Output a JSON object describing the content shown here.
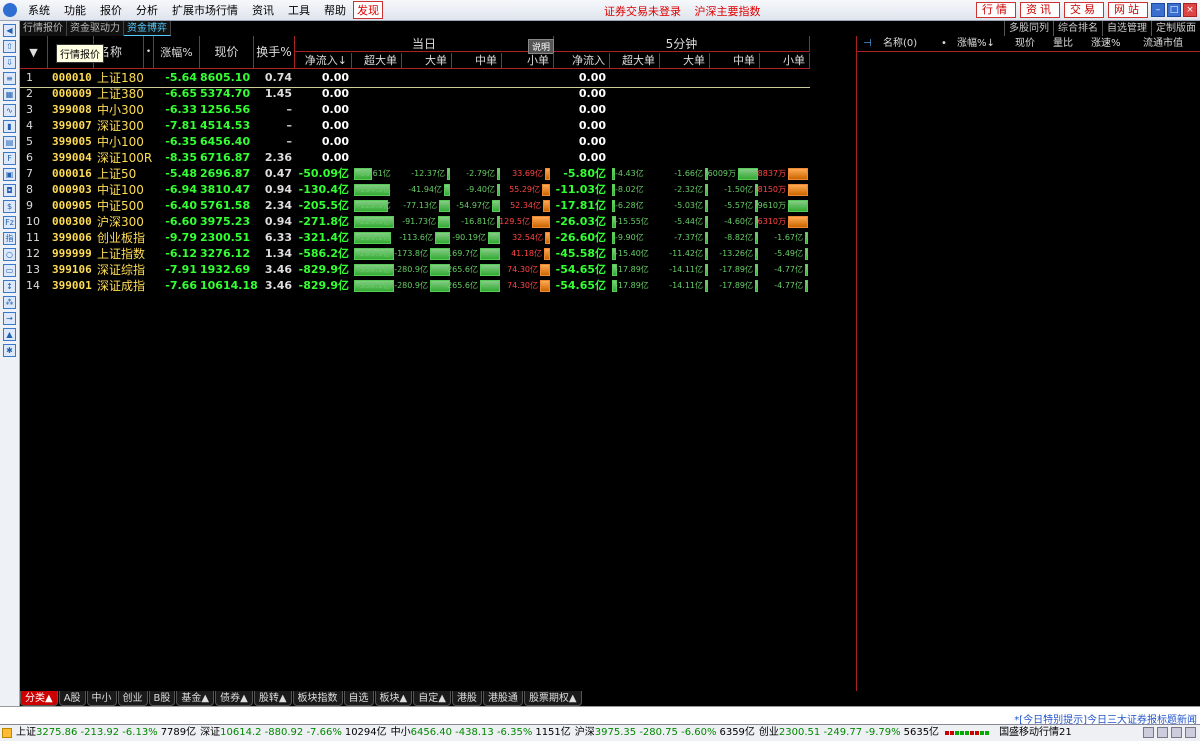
{
  "menu": [
    "系统",
    "功能",
    "报价",
    "分析",
    "扩展市场行情",
    "资讯",
    "工具",
    "帮助"
  ],
  "menu_red": "发现",
  "center_notices": [
    "证券交易未登录",
    "沪深主要指数"
  ],
  "right_buttons": [
    "行情",
    "资讯",
    "交易",
    "网站"
  ],
  "tabs": [
    "行情报价",
    "资金驱动力",
    "资金博弈"
  ],
  "right_tabs": [
    "多股同列",
    "综合排名",
    "自选管理",
    "定制版面"
  ],
  "tooltip": "行情报价",
  "header": {
    "sort_arrow": "▼",
    "code_partial": "代",
    "name": "名称",
    "dot": "•",
    "pct": "涨幅%",
    "price": "现价",
    "turnover": "换手%",
    "today": "当日",
    "five_min": "5分钟",
    "shuoming": "说明",
    "net_in": "净流入↓",
    "super_big": "超大单",
    "big": "大单",
    "mid": "中单",
    "small": "小单",
    "net_in2": "净流入",
    "big2": "大单",
    "mid2": "中单",
    "small2": "小单"
  },
  "rows": [
    {
      "i": "1",
      "code": "000010",
      "name": "上证180",
      "pct": "-5.64",
      "price": "8605.10",
      "turn": "0.74",
      "net": "0.00",
      "net2": "0.00",
      "bars": null
    },
    {
      "i": "2",
      "code": "000009",
      "name": "上证380",
      "pct": "-6.65",
      "price": "5374.70",
      "turn": "1.45",
      "net": "0.00",
      "net2": "0.00",
      "bars": null
    },
    {
      "i": "3",
      "code": "399008",
      "name": "中小300",
      "pct": "-6.33",
      "price": "1256.56",
      "turn": "–",
      "net": "0.00",
      "net2": "0.00",
      "bars": null
    },
    {
      "i": "4",
      "code": "399007",
      "name": "深证300",
      "pct": "-7.81",
      "price": "4514.53",
      "turn": "–",
      "net": "0.00",
      "net2": "0.00",
      "bars": null
    },
    {
      "i": "5",
      "code": "399005",
      "name": "中小100",
      "pct": "-6.35",
      "price": "6456.40",
      "turn": "–",
      "net": "0.00",
      "net2": "0.00",
      "bars": null
    },
    {
      "i": "6",
      "code": "399004",
      "name": "深证100R",
      "pct": "-8.35",
      "price": "6716.87",
      "turn": "2.36",
      "net": "0.00",
      "net2": "0.00",
      "bars": null
    },
    {
      "i": "7",
      "code": "000016",
      "name": "上证50",
      "pct": "-5.48",
      "price": "2696.87",
      "turn": "0.47",
      "net": "-50.09亿",
      "net2": "-5.80亿",
      "bars": {
        "d": [
          "-68.61亿",
          "-12.37亿",
          "-2.79亿",
          "33.69亿"
        ],
        "m": [
          "-4.43亿",
          "-1.66亿",
          "-6009万",
          "8837万"
        ]
      }
    },
    {
      "i": "8",
      "code": "000903",
      "name": "中证100",
      "pct": "-6.94",
      "price": "3810.47",
      "turn": "0.94",
      "net": "-130.4亿",
      "net2": "-11.03亿",
      "bars": {
        "d": [
          "-134.3亿",
          "-41.94亿",
          "-9.40亿",
          "55.29亿"
        ],
        "m": [
          "-8.02亿",
          "-2.32亿",
          "-1.50亿",
          "8150万"
        ]
      }
    },
    {
      "i": "9",
      "code": "000905",
      "name": "中证500",
      "pct": "-6.40",
      "price": "5761.58",
      "turn": "2.34",
      "net": "-205.5亿",
      "net2": "-17.81亿",
      "bars": {
        "d": [
          "-125.8亿",
          "-77.13亿",
          "-54.97亿",
          "52.34亿"
        ],
        "m": [
          "-6.28亿",
          "-5.03亿",
          "-5.57亿",
          "-9610万"
        ]
      }
    },
    {
      "i": "10",
      "code": "000300",
      "name": "沪深300",
      "pct": "-6.60",
      "price": "3975.23",
      "turn": "0.94",
      "net": "-271.8亿",
      "net2": "-26.03亿",
      "bars": {
        "d": [
          "-229.8亿",
          "-91.73亿",
          "-16.81亿",
          "129.5亿"
        ],
        "m": [
          "-15.55亿",
          "-5.44亿",
          "-4.60亿",
          "6310万"
        ]
      }
    },
    {
      "i": "11",
      "code": "399006",
      "name": "创业板指",
      "pct": "-9.79",
      "price": "2300.51",
      "turn": "6.33",
      "net": "-321.4亿",
      "net2": "-26.60亿",
      "bars": {
        "d": [
          "-139.1亿",
          "-113.6亿",
          "-90.19亿",
          "32.54亿"
        ],
        "m": [
          "-9.90亿",
          "-7.37亿",
          "-8.82亿",
          "-1.67亿"
        ]
      }
    },
    {
      "i": "12",
      "code": "999999",
      "name": "上证指数",
      "pct": "-6.12",
      "price": "3276.12",
      "turn": "1.34",
      "net": "-586.2亿",
      "net2": "-45.58亿",
      "bars": {
        "d": [
          "-283.9亿",
          "-173.8亿",
          "-169.7亿",
          "41.18亿"
        ],
        "m": [
          "-15.40亿",
          "-11.42亿",
          "-13.26亿",
          "-5.49亿"
        ]
      }
    },
    {
      "i": "13",
      "code": "399106",
      "name": "深证综指",
      "pct": "-7.91",
      "price": "1932.69",
      "turn": "3.46",
      "net": "-829.9亿",
      "net2": "-54.65亿",
      "bars": {
        "d": [
          "-358.1亿",
          "-280.9亿",
          "-265.6亿",
          "74.30亿"
        ],
        "m": [
          "-17.89亿",
          "-14.11亿",
          "-17.89亿",
          "-4.77亿"
        ]
      }
    },
    {
      "i": "14",
      "code": "399001",
      "name": "深证成指",
      "pct": "-7.66",
      "price": "10614.18",
      "turn": "3.46",
      "net": "-829.9亿",
      "net2": "-54.65亿",
      "bars": {
        "d": [
          "-358.1亿",
          "-280.9亿",
          "-265.6亿",
          "74.30亿"
        ],
        "m": [
          "-17.89亿",
          "-14.11亿",
          "-17.89亿",
          "-4.77亿"
        ]
      }
    }
  ],
  "rpanel_head": {
    "pin": "⊣",
    "name": "名称(0)",
    "dot": "•",
    "pct": "涨幅%↓",
    "price": "现价",
    "vol_ratio": "量比",
    "speed": "涨速%",
    "circ": "流通市值"
  },
  "bottom_tabs": [
    "分类▲",
    "A股",
    "中小",
    "创业",
    "B股",
    "基金▲",
    "债券▲",
    "股转▲",
    "板块指数",
    "自选",
    "板块▲",
    "自定▲",
    "港股",
    "港股通",
    "股票期权▲"
  ],
  "notice": "*[今日特别提示]今日三大证券报标题新闻",
  "status": [
    {
      "label": "上证",
      "value": "3275.86 -213.92 -6.13%",
      "vol": "7789亿"
    },
    {
      "label": "深证",
      "value": "10614.2 -880.92 -7.66%",
      "vol": "10294亿"
    },
    {
      "label": "中小",
      "value": "6456.40 -438.13 -6.35%",
      "vol": "1151亿"
    },
    {
      "label": "沪深",
      "value": "3975.35 -280.75 -6.60%",
      "vol": "6359亿"
    },
    {
      "label": "创业",
      "value": "2300.51 -249.77 -9.79%",
      "vol": "5635亿"
    }
  ],
  "carrier": "国盛移动行情21"
}
